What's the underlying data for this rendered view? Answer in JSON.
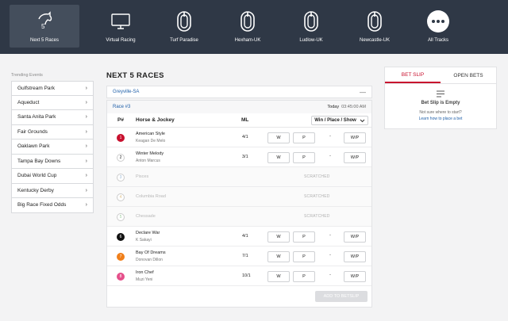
{
  "nav": [
    {
      "label": "Next 5 Races",
      "icon": "horse-head-icon",
      "active": true
    },
    {
      "label": "Virtual Racing",
      "icon": "monitor-icon",
      "active": false
    },
    {
      "label": "Turf Paradise",
      "icon": "track-oval-icon",
      "active": false
    },
    {
      "label": "Hexham-UK",
      "icon": "track-oval-icon",
      "active": false
    },
    {
      "label": "Ludlow-UK",
      "icon": "track-oval-icon",
      "active": false
    },
    {
      "label": "Newcastle-UK",
      "icon": "track-oval-icon",
      "active": false
    },
    {
      "label": "All Tracks",
      "icon": "more-dots-icon",
      "active": false
    }
  ],
  "nav_badge": "5",
  "sidebar": {
    "title": "Trending Events",
    "items": [
      "Gulfstream Park",
      "Aqueduct",
      "Santa Anita Park",
      "Fair Grounds",
      "Oaklawn Park",
      "Tampa Bay Downs",
      "Dubai World Cup",
      "Kentucky Derby",
      "Big Race Fixed Odds"
    ]
  },
  "main": {
    "title": "NEXT 5 RACES",
    "track": "Greyville-SA",
    "collapse_symbol": "—",
    "race": "Race #3",
    "day": "Today",
    "time": "03:45:00 AM",
    "columns": {
      "post": "P#",
      "horse": "Horse & Jockey",
      "ml": "ML",
      "bet_type": "Win / Place / Show"
    },
    "runners": [
      {
        "num": "1",
        "color": "#c8102e",
        "text_color": "#ffffff",
        "horse": "American Style",
        "jockey": "Keagan De Melo",
        "ml": "4/1",
        "scratched": false
      },
      {
        "num": "2",
        "color": "#ffffff",
        "text_color": "#222222",
        "horse": "Winter Melody",
        "jockey": "Anton Marcus",
        "ml": "3/1",
        "scratched": false
      },
      {
        "num": "3",
        "color": "#ffffff",
        "text_color": "#9ab8d6",
        "horse": "Pisces",
        "jockey": "",
        "ml": "",
        "scratched": true
      },
      {
        "num": "4",
        "color": "#ffffff",
        "text_color": "#e0c28a",
        "horse": "Columbia Road",
        "jockey": "",
        "ml": "",
        "scratched": true
      },
      {
        "num": "5",
        "color": "#ffffff",
        "text_color": "#9fd09f",
        "horse": "Chessade",
        "jockey": "",
        "ml": "",
        "scratched": true
      },
      {
        "num": "6",
        "color": "#111111",
        "text_color": "#ffffff",
        "horse": "Declare War",
        "jockey": "K Sakayi",
        "ml": "4/1",
        "scratched": false
      },
      {
        "num": "7",
        "color": "#f07f1a",
        "text_color": "#ffffff",
        "horse": "Bay Of Dreams",
        "jockey": "Donovan Dillon",
        "ml": "7/1",
        "scratched": false
      },
      {
        "num": "8",
        "color": "#e54f8a",
        "text_color": "#ffffff",
        "horse": "Iron Chef",
        "jockey": "Muzi Yeni",
        "ml": "10/1",
        "scratched": false
      }
    ],
    "bet_labels": {
      "w": "W",
      "p": "P",
      "dash": "-",
      "wp": "W/P"
    },
    "scratched_label": "SCRATCHED",
    "add_button": "ADD TO BETSLIP"
  },
  "betslip": {
    "tab_slip": "BET SLIP",
    "tab_open": "OPEN BETS",
    "empty": "Bet Slip is Empty",
    "sub": "Not sure where to start?",
    "link": "Learn how to place a bet"
  }
}
